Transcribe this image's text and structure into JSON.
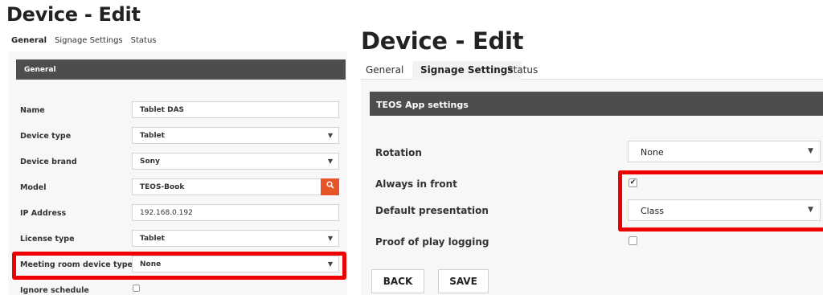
{
  "left": {
    "title": "Device - Edit",
    "tabs": [
      "General",
      "Signage Settings",
      "Status"
    ],
    "section": "General",
    "fields": {
      "name": {
        "label": "Name",
        "value": "Tablet DAS"
      },
      "device_type": {
        "label": "Device type",
        "value": "Tablet"
      },
      "device_brand": {
        "label": "Device brand",
        "value": "Sony"
      },
      "model": {
        "label": "Model",
        "value": "TEOS-Book"
      },
      "ip_address": {
        "label": "IP Address",
        "value": "192.168.0.192"
      },
      "license_type": {
        "label": "License type",
        "value": "Tablet"
      },
      "meeting_room_type": {
        "label": "Meeting room device type",
        "value": "None"
      },
      "ignore_schedule": {
        "label": "Ignore schedule",
        "checked": false
      }
    }
  },
  "right": {
    "title": "Device - Edit",
    "tabs": [
      "General",
      "Signage Settings",
      "Status"
    ],
    "active_tab": "Signage Settings",
    "section": "TEOS App settings",
    "fields": {
      "rotation": {
        "label": "Rotation",
        "value": "None"
      },
      "always_in_front": {
        "label": "Always in front",
        "checked": true
      },
      "default_presentation": {
        "label": "Default presentation",
        "value": "Class"
      },
      "proof_of_play": {
        "label": "Proof of play logging",
        "checked": false
      }
    },
    "buttons": {
      "back": "BACK",
      "save": "SAVE"
    }
  },
  "icons": {
    "dropdown": "caret-down-icon",
    "search": "search-icon",
    "check": "checkmark-icon"
  },
  "colors": {
    "section_header": "#4d4d4d",
    "search_button": "#e8542a",
    "highlight": "#ee0000"
  }
}
